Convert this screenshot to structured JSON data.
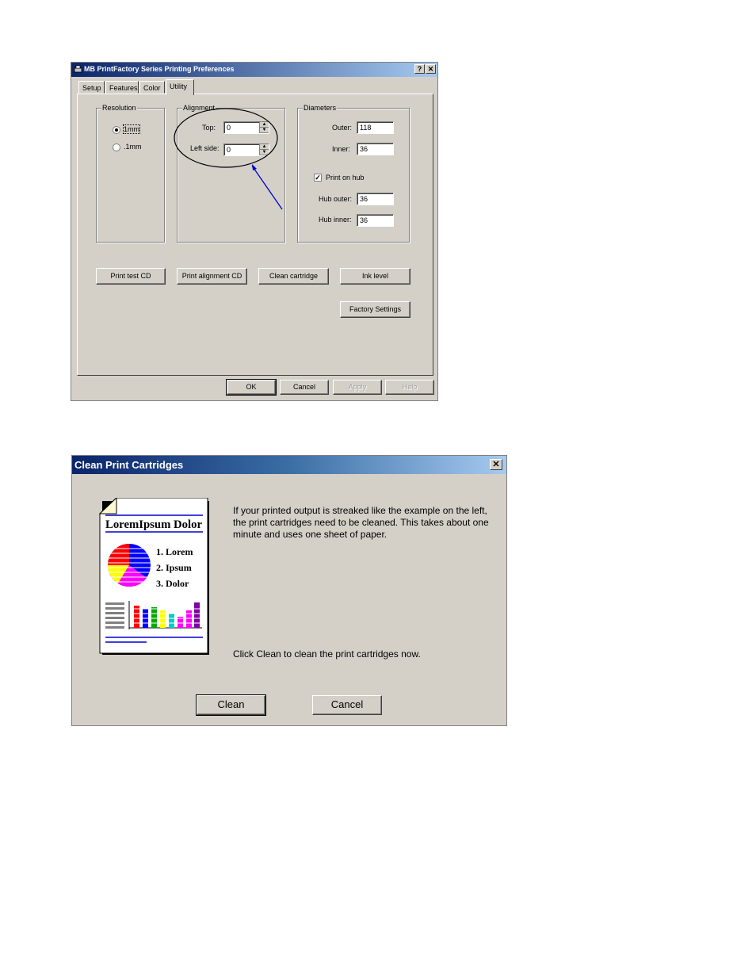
{
  "prefs": {
    "title": "MB PrintFactory Series Printing Preferences",
    "help_btn": "?",
    "close_btn": "✕",
    "tabs": [
      {
        "label": "Setup"
      },
      {
        "label": "Features"
      },
      {
        "label": "Color"
      },
      {
        "label": "Utility"
      }
    ],
    "resolution": {
      "legend": "Resolution",
      "options": [
        "1mm",
        ".1mm"
      ],
      "selected": "1mm"
    },
    "alignment": {
      "legend": "Alignment",
      "top_label": "Top:",
      "top_value": "0",
      "left_label": "Left side:",
      "left_value": "0"
    },
    "diameters": {
      "legend": "Diameters",
      "outer_label": "Outer:",
      "outer_value": "118",
      "inner_label": "Inner:",
      "inner_value": "36",
      "print_on_hub_label": "Print on hub",
      "print_on_hub_checked": true,
      "hub_outer_label": "Hub outer:",
      "hub_outer_value": "36",
      "hub_inner_label": "Hub inner:",
      "hub_inner_value": "36"
    },
    "buttons": {
      "print_test_cd": "Print test CD",
      "print_alignment_cd": "Print alignment CD",
      "clean_cartridge": "Clean cartridge",
      "ink_level": "Ink level",
      "factory_settings": "Factory Settings",
      "ok": "OK",
      "cancel": "Cancel",
      "apply": "Apply",
      "help": "Help"
    },
    "annotation_color": "#0000cc"
  },
  "clean": {
    "title": "Clean Print Cartridges",
    "close_btn": "✕",
    "message": "If your printed output is streaked like the example on the left, the print cartridges need to be cleaned.  This takes about one minute and uses one sheet of paper.",
    "instruction": "Click Clean to clean the print cartridges now.",
    "clean_button": "Clean",
    "cancel_button": "Cancel",
    "illustration": {
      "heading": "LoremIpsum Dolor",
      "items": [
        "1. Lorem",
        "2. Ipsum",
        "3. Dolor"
      ]
    }
  }
}
